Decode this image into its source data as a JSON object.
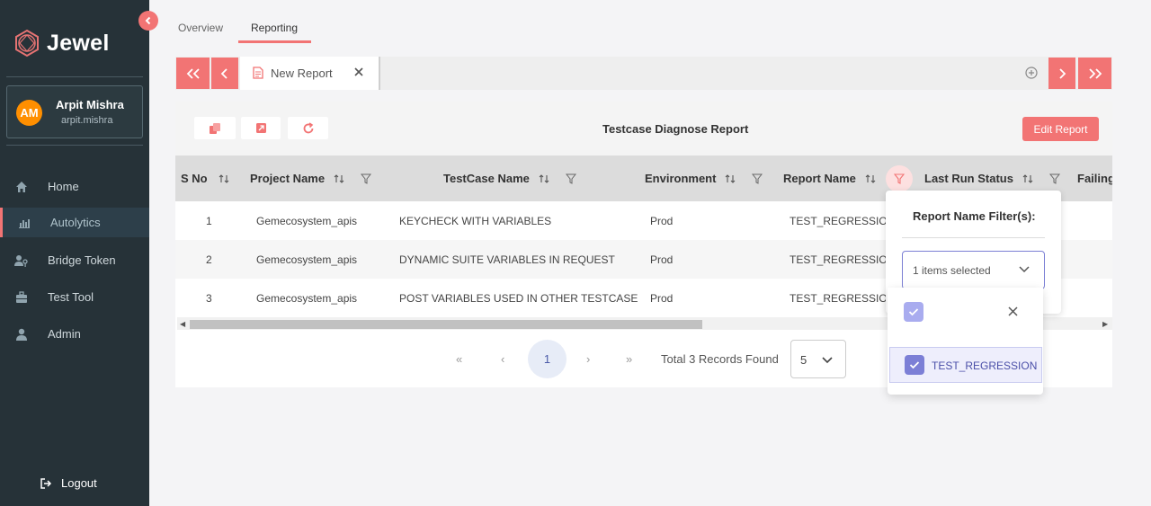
{
  "app": {
    "name": "Jewel"
  },
  "user": {
    "initials": "AM",
    "name": "Arpit Mishra",
    "handle": "arpit.mishra"
  },
  "sidebar": {
    "items": [
      {
        "label": "Home",
        "icon": "home-icon"
      },
      {
        "label": "Autolytics",
        "icon": "bar-chart-icon"
      },
      {
        "label": "Bridge Token",
        "icon": "users-key-icon"
      },
      {
        "label": "Test Tool",
        "icon": "toolbox-icon"
      },
      {
        "label": "Admin",
        "icon": "user-icon"
      }
    ],
    "active": "Autolytics",
    "logout": "Logout"
  },
  "tabs": {
    "overview": "Overview",
    "reporting": "Reporting",
    "active": "Reporting"
  },
  "report_tab": {
    "label": "New Report"
  },
  "report": {
    "title": "Testcase Diagnose Report",
    "edit_label": "Edit Report"
  },
  "table": {
    "columns": [
      "S No",
      "Project Name",
      "TestCase Name",
      "Environment",
      "Report Name",
      "Last Run Status",
      "Failing"
    ],
    "rows": [
      {
        "sno": "1",
        "project": "Gemecosystem_apis",
        "testcase": "KEYCHECK WITH VARIABLES",
        "env": "Prod",
        "report": "TEST_REGRESSION"
      },
      {
        "sno": "2",
        "project": "Gemecosystem_apis",
        "testcase": "DYNAMIC SUITE VARIABLES IN REQUEST",
        "env": "Prod",
        "report": "TEST_REGRESSION"
      },
      {
        "sno": "3",
        "project": "Gemecosystem_apis",
        "testcase": "POST VARIABLES USED IN OTHER TESTCASE",
        "env": "Prod",
        "report": "TEST_REGRESSION"
      }
    ]
  },
  "pagination": {
    "first": "«",
    "prev": "‹",
    "current_page": "1",
    "next": "›",
    "last": "»",
    "total": "Total 3 Records Found",
    "rows_per_page": "5"
  },
  "filter": {
    "title": "Report Name Filter(s):",
    "selected_text": "1 items selected",
    "options": [
      {
        "label": "TEST_REGRESSION",
        "checked": true
      }
    ]
  },
  "colors": {
    "accent": "#f27474",
    "sidebar": "#263238",
    "check": "#7c7fd6"
  }
}
